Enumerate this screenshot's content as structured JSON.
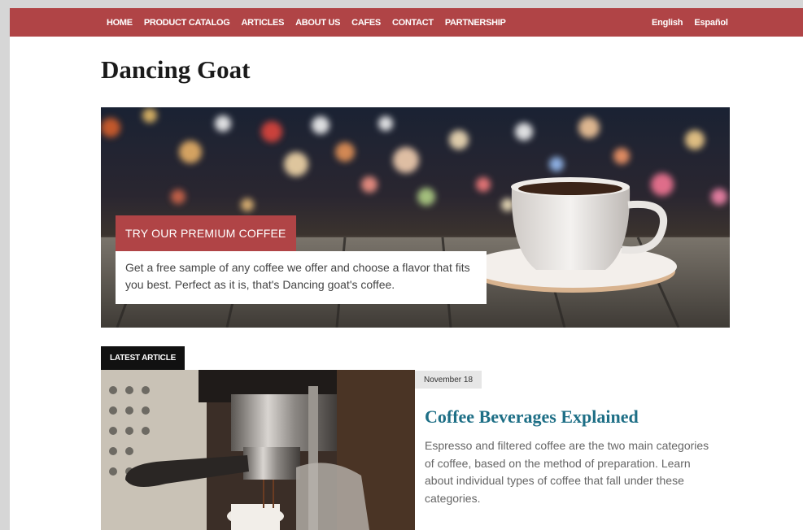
{
  "nav": {
    "items": [
      {
        "label": "HOME"
      },
      {
        "label": "PRODUCT CATALOG"
      },
      {
        "label": "ARTICLES"
      },
      {
        "label": "ABOUT US"
      },
      {
        "label": "CAFES"
      },
      {
        "label": "CONTACT"
      },
      {
        "label": "PARTNERSHIP"
      }
    ],
    "languages": [
      {
        "label": "English"
      },
      {
        "label": "Español"
      }
    ]
  },
  "site": {
    "title": "Dancing Goat"
  },
  "hero": {
    "badge": "TRY OUR PREMIUM COFFEE",
    "text": "Get a free sample of any coffee we offer and choose a flavor that fits you best. Perfect as it is, that's Dancing goat's coffee."
  },
  "latest": {
    "tag": "LATEST ARTICLE",
    "date": "November 18",
    "title": "Coffee Beverages Explained",
    "summary": "Espresso and filtered coffee are the two main categories of coffee, based on the method of preparation. Learn about individual types of coffee that fall under these categories."
  },
  "colors": {
    "brand": "#b04446",
    "article_title": "#1e6f86"
  }
}
